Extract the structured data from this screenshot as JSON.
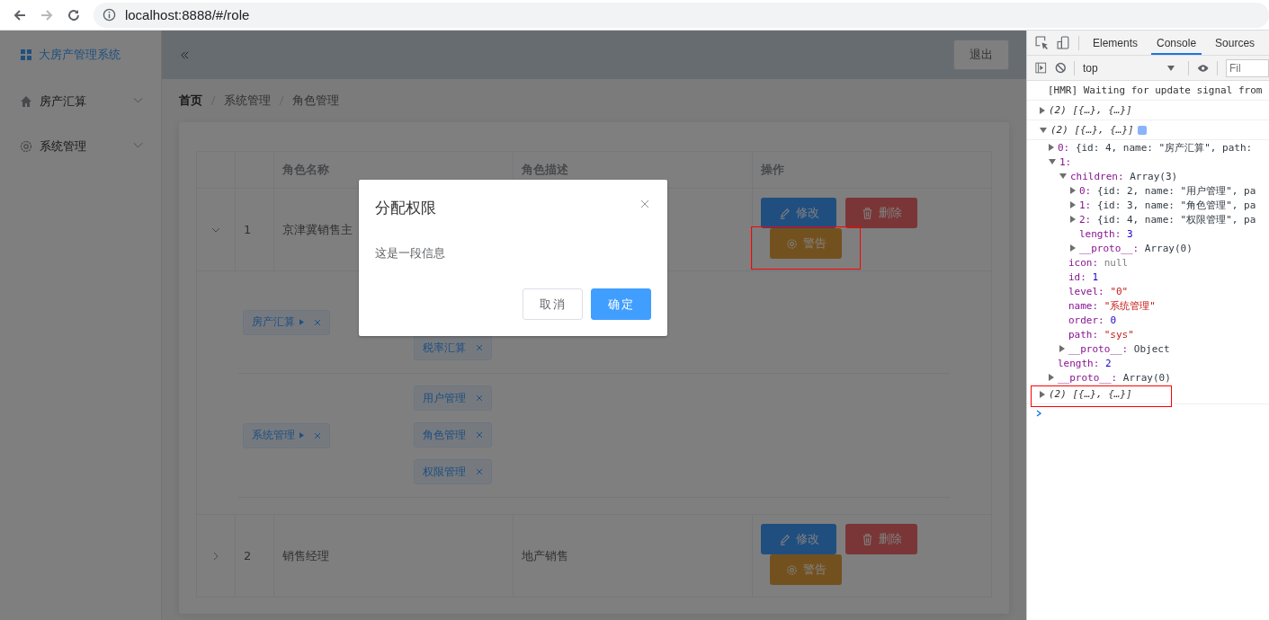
{
  "browser": {
    "url": "localhost:8888/#/role"
  },
  "sidebar": {
    "logo": "大房产管理系统",
    "items": [
      {
        "label": "房产汇算",
        "kind": "home"
      },
      {
        "label": "系统管理",
        "kind": "gear"
      }
    ]
  },
  "header": {
    "logout": "退出"
  },
  "breadcrumb": [
    "首页",
    "系统管理",
    "角色管理"
  ],
  "table": {
    "columns": [
      "角色名称",
      "角色描述",
      "操作"
    ],
    "rows": [
      {
        "index": "1",
        "name": "京津冀销售主",
        "expanded": true,
        "actions": [
          {
            "label": "修改",
            "kind": "edit"
          },
          {
            "label": "删除",
            "kind": "delete"
          },
          {
            "label": "警告",
            "kind": "warn",
            "highlighted": true
          }
        ],
        "rights": [
          {
            "label": "房产汇算",
            "children": [
              "税率汇算"
            ]
          },
          {
            "label": "系统管理",
            "children": [
              "用户管理",
              "角色管理",
              "权限管理"
            ]
          }
        ]
      },
      {
        "index": "2",
        "name": "销售经理",
        "description": "地产销售",
        "expanded": false,
        "actions": [
          {
            "label": "修改",
            "kind": "edit"
          },
          {
            "label": "删除",
            "kind": "delete"
          },
          {
            "label": "警告",
            "kind": "warn",
            "highlighted": false
          }
        ]
      }
    ]
  },
  "dialog": {
    "title": "分配权限",
    "message": "这是一段信息",
    "buttons": [
      {
        "label": "取消",
        "kind": "default"
      },
      {
        "label": "确定",
        "kind": "primary"
      }
    ]
  },
  "devtools": {
    "tabs": [
      {
        "label": "Elements",
        "selected": false
      },
      {
        "label": "Console",
        "selected": true
      },
      {
        "label": "Sources",
        "selected": false
      }
    ],
    "context": "top",
    "filter_placeholder": "Fil",
    "console": [
      {
        "text": "[HMR] Waiting for update signal from"
      },
      {
        "summary": "(2) [{…}, {…}]",
        "expanded": false
      },
      {
        "summary": "(2) [{…}, {…}]",
        "expanded": true,
        "info": true,
        "children": [
          {
            "key": "0:",
            "value": "{id: 4, name: \"房产汇算\", path:",
            "expanded": false
          },
          {
            "key": "1:",
            "expanded": true,
            "children": [
              {
                "key": "children:",
                "value": "Array(3)",
                "expanded": true,
                "children": [
                  {
                    "key": "0:",
                    "value": "{id: 2, name: \"用户管理\", pa",
                    "expanded": false
                  },
                  {
                    "key": "1:",
                    "value": "{id: 3, name: \"角色管理\", pa",
                    "expanded": false
                  },
                  {
                    "key": "2:",
                    "value": "{id: 4, name: \"权限管理\", pa",
                    "expanded": false
                  },
                  {
                    "key": "length:",
                    "value": "3",
                    "kind": "number"
                  },
                  {
                    "key": "__proto__:",
                    "value": "Array(0)",
                    "expanded": false
                  }
                ]
              },
              {
                "key": "icon:",
                "value": "null",
                "kind": "null"
              },
              {
                "key": "id:",
                "value": "1",
                "kind": "number"
              },
              {
                "key": "level:",
                "value": "\"0\"",
                "kind": "string"
              },
              {
                "key": "name:",
                "value": "\"系统管理\"",
                "kind": "string"
              },
              {
                "key": "order:",
                "value": "0",
                "kind": "number"
              },
              {
                "key": "path:",
                "value": "\"sys\"",
                "kind": "string"
              },
              {
                "key": "__proto__:",
                "value": "Object",
                "expanded": false
              }
            ]
          },
          {
            "key": "length:",
            "value": "2",
            "kind": "number"
          },
          {
            "key": "__proto__:",
            "value": "Array(0)",
            "expanded": false
          }
        ]
      },
      {
        "summary": "(2) [{…}, {…}]",
        "expanded": false,
        "highlighted": true
      }
    ]
  }
}
